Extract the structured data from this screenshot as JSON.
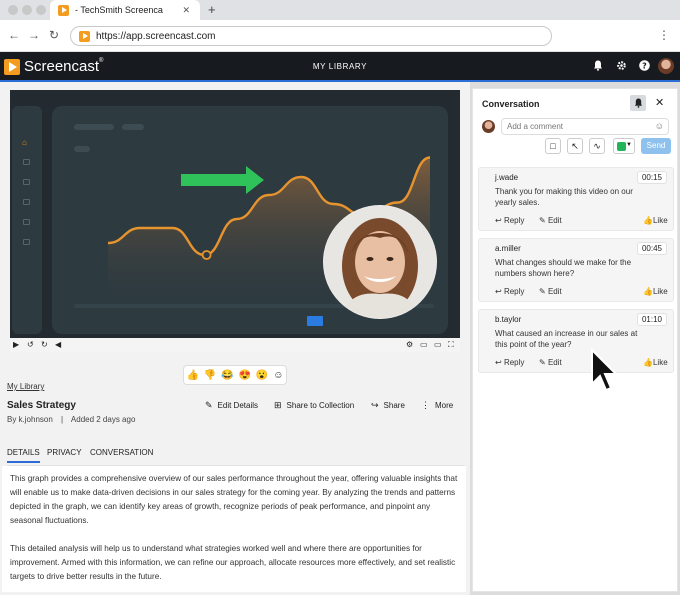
{
  "browser": {
    "tab_title": "- TechSmith Screenca",
    "tab_close": "✕",
    "new_tab": "+",
    "url": "https://app.screencast.com",
    "back": "←",
    "forward": "→",
    "reload": "↻",
    "menu": "⋮"
  },
  "header": {
    "logo": "Screencast",
    "logo_mark": "®",
    "title": "MY LIBRARY"
  },
  "video": {
    "chart_data": {
      "type": "line",
      "description_hidden": "",
      "series": [
        {
          "values": [
            0.62,
            0.52,
            0.52,
            0.7,
            0.46,
            0.3,
            0.18,
            0.36,
            0.44,
            0.35,
            0.05
          ]
        }
      ]
    }
  },
  "reactions": [
    "👍",
    "👎",
    "😂",
    "😍",
    "😮",
    "☺"
  ],
  "breadcrumb": "My Library",
  "video_title": "Sales Strategy",
  "meta": {
    "author": "By k.johnson",
    "separator": "|",
    "added": "Added 2 days ago"
  },
  "actions": {
    "edit_details": "Edit Details",
    "share_collection": "Share to Collection",
    "share": "Share",
    "more": "More"
  },
  "tabs": [
    "DETAILS",
    "PRIVACY",
    "CONVERSATION"
  ],
  "details": {
    "p1": "This graph provides a comprehensive overview of our sales performance throughout the year, offering valuable insights that will enable us to make data-driven decisions in our sales strategy for the coming year. By analyzing the trends and patterns depicted in the graph, we can identify key areas of growth, recognize periods of peak performance, and pinpoint any seasonal fluctuations.",
    "p2": "This detailed analysis will help us to understand what strategies worked well and where there are opportunities for improvement. Armed with this information, we can refine our approach, allocate resources more effectively, and set realistic targets to drive better results in the future."
  },
  "conversation": {
    "title": "Conversation",
    "placeholder": "Add a comment",
    "send": "Send",
    "comments": [
      {
        "user": "j.wade",
        "time": "00:15",
        "text": "Thank you for making this video on our yearly sales.",
        "reply": "Reply",
        "edit": "Edit",
        "like": "Like"
      },
      {
        "user": "a.miller",
        "time": "00:45",
        "text": "What changes should we make for the numbers shown here?",
        "reply": "Reply",
        "edit": "Edit",
        "like": "Like"
      },
      {
        "user": "b.taylor",
        "time": "01:10",
        "text": "What caused an increase in our sales at this point of the year?",
        "reply": "Reply",
        "edit": "Edit",
        "like": "Like"
      }
    ]
  },
  "colors": {
    "accent": "#2b6fd6",
    "brand": "#f39c1f",
    "line": "#e8942e",
    "arrow": "#2fc25b",
    "send": "#8ec1ee"
  }
}
